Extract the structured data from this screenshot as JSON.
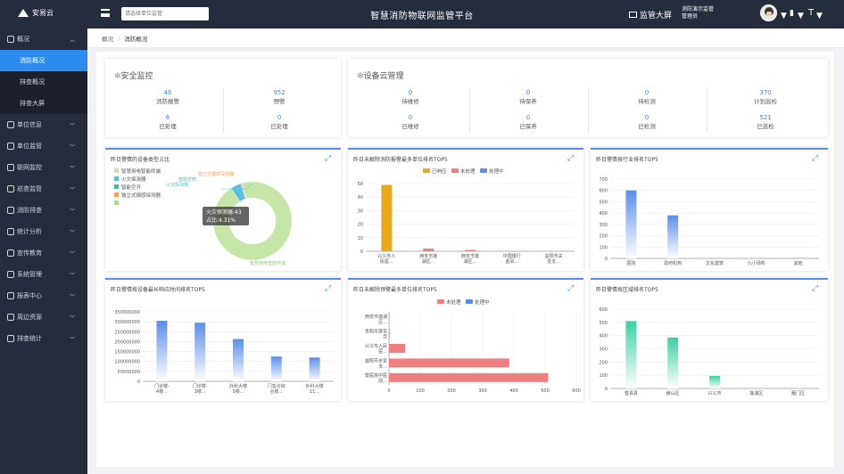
{
  "header": {
    "logo_text": "安易云",
    "search_placeholder": "请选择单位监管",
    "title": "智慧消防物联网监管平台",
    "bigscreen_label": "监管大屏",
    "user_name": "消防演示监管",
    "user_role": "管理员"
  },
  "sidebar": {
    "items": [
      {
        "label": "概况",
        "icon": "home-icon",
        "expanded": true
      },
      {
        "label": "单位信息",
        "icon": "building-icon"
      },
      {
        "label": "单位监管",
        "icon": "shield-icon"
      },
      {
        "label": "联网监控",
        "icon": "monitor-icon"
      },
      {
        "label": "巡查监管",
        "icon": "eye-icon"
      },
      {
        "label": "消防排查",
        "icon": "check-icon"
      },
      {
        "label": "统计分析",
        "icon": "chart-icon"
      },
      {
        "label": "宣传教育",
        "icon": "book-icon"
      },
      {
        "label": "系统管理",
        "icon": "gear-icon"
      },
      {
        "label": "报表中心",
        "icon": "report-icon"
      },
      {
        "label": "周边资源",
        "icon": "location-icon"
      },
      {
        "label": "排查统计",
        "icon": "list-icon"
      }
    ],
    "subitems": [
      {
        "label": "消防概况",
        "active": true
      },
      {
        "label": "排查概况",
        "active": false
      },
      {
        "label": "排查大屏",
        "active": false
      }
    ]
  },
  "breadcrumb": {
    "home": "概况",
    "sep": "/",
    "current": "消防概况"
  },
  "safety": {
    "title": "安全监控",
    "stats": [
      {
        "value": "46",
        "label": "消防报警"
      },
      {
        "value": "952",
        "label": "预警"
      },
      {
        "value": "6",
        "label": "已处理"
      },
      {
        "value": "0",
        "label": "已处理"
      }
    ]
  },
  "device": {
    "title": "设备云管理",
    "stats": [
      {
        "value": "0",
        "label": "待维修"
      },
      {
        "value": "0",
        "label": "待保养"
      },
      {
        "value": "0",
        "label": "待检测"
      },
      {
        "value": "370",
        "label": "计划巡检"
      },
      {
        "value": "0",
        "label": "已维修"
      },
      {
        "value": "0",
        "label": "已保养"
      },
      {
        "value": "0",
        "label": "已检测"
      },
      {
        "value": "521",
        "label": "已巡检"
      }
    ]
  },
  "panels": {
    "p1": {
      "title": "昨日警情的设备类型占比"
    },
    "p2": {
      "title": "昨日未解除消防报警最多单位排名TOP5"
    },
    "p3": {
      "title": "昨日警情按行业排名TOP5"
    },
    "p4": {
      "title": "昨日警情按设备最长响应时间排名TOP5"
    },
    "p5": {
      "title": "昨日未解除预警最多单位排名TOP5"
    },
    "p6": {
      "title": "昨日警情按区域排名TOP5"
    }
  },
  "chart_data": [
    {
      "type": "pie",
      "legend": [
        "智慧用电智能终端",
        "火灾探测器",
        "智能空开",
        "独立式烟感探测器",
        ""
      ],
      "colors": [
        "#c5e6a6",
        "#5bc0de",
        "#3fbf9f",
        "#f3a15a",
        "#a0e07c"
      ],
      "slices": [
        {
          "label": "智慧用电智能终端",
          "value": 95.0
        },
        {
          "label": "火灾探测器",
          "value": 4.31
        },
        {
          "label": "智能空开",
          "value": 0.3
        },
        {
          "label": "独立式烟感探测器",
          "value": 0.39
        }
      ],
      "tooltip": {
        "line1": "火灾探测器:43",
        "line2": "占比:4.31%"
      }
    },
    {
      "type": "bar",
      "legend": [
        "已响应",
        "未处理",
        "处理中"
      ],
      "legend_colors": [
        "#e8a91c",
        "#ef7f7f",
        "#5c8de8"
      ],
      "categories": [
        "兴义市人民医...",
        "西安市莲湖区...",
        "西安市莲湖区...",
        "中国银行金凤...",
        "益阳市关爱支..."
      ],
      "series": [
        {
          "name": "已响应",
          "values": [
            49,
            0,
            0,
            0,
            0
          ]
        },
        {
          "name": "未处理",
          "values": [
            0,
            2,
            1,
            0,
            0
          ]
        },
        {
          "name": "处理中",
          "values": [
            0,
            0,
            0,
            0,
            0
          ]
        }
      ],
      "yticks": [
        "0",
        "10",
        "20",
        "30",
        "40",
        "50"
      ],
      "ylim": [
        0,
        50
      ]
    },
    {
      "type": "bar",
      "categories": [
        "医院",
        "政府机构",
        "文化建筑",
        "九小场所",
        "其他"
      ],
      "values": [
        600,
        380,
        5,
        3,
        2
      ],
      "yticks": [
        "0",
        "100",
        "200",
        "300",
        "400",
        "500",
        "600",
        "700"
      ],
      "ylim": [
        0,
        700
      ],
      "color": "#5c8de8"
    },
    {
      "type": "bar",
      "categories": [
        "门诊楼-4楼...",
        "门诊楼-3楼...",
        "外科大楼5楼...",
        "门急诊综合楼...",
        "外科大楼11..."
      ],
      "values": [
        305000000,
        295000000,
        213000000,
        125000000,
        120000000
      ],
      "yticks": [
        "0",
        "50000000",
        "100000000",
        "150000000",
        "200000000",
        "250000000",
        "300000000",
        "350000000"
      ],
      "ylim": [
        0,
        350000000
      ],
      "color": "#5c8de8"
    },
    {
      "type": "bar",
      "orientation": "horizontal",
      "legend": [
        "未处理",
        "处理中"
      ],
      "legend_colors": [
        "#ef7f7f",
        "#5c8de8"
      ],
      "categories": [
        "西安市莲湖区...",
        "贵阳市莲花寺",
        "兴义市人民医...",
        "益阳市关爱支...",
        "暨医院中医院..."
      ],
      "series": [
        {
          "name": "未处理",
          "values": [
            1,
            2,
            52,
            385,
            510
          ]
        },
        {
          "name": "处理中",
          "values": [
            0,
            0,
            0,
            0,
            0
          ]
        }
      ],
      "xticks": [
        "0",
        "100",
        "200",
        "300",
        "400",
        "500",
        "600"
      ],
      "xlim": [
        0,
        600
      ]
    },
    {
      "type": "bar",
      "categories": [
        "暨县县",
        "赫山区",
        "兴义市",
        "莲湖区",
        "雁门区"
      ],
      "values": [
        510,
        385,
        95,
        5,
        3
      ],
      "yticks": [
        "0",
        "100",
        "200",
        "300",
        "400",
        "500",
        "600"
      ],
      "ylim": [
        0,
        600
      ],
      "color": "#3ecfa6"
    }
  ]
}
